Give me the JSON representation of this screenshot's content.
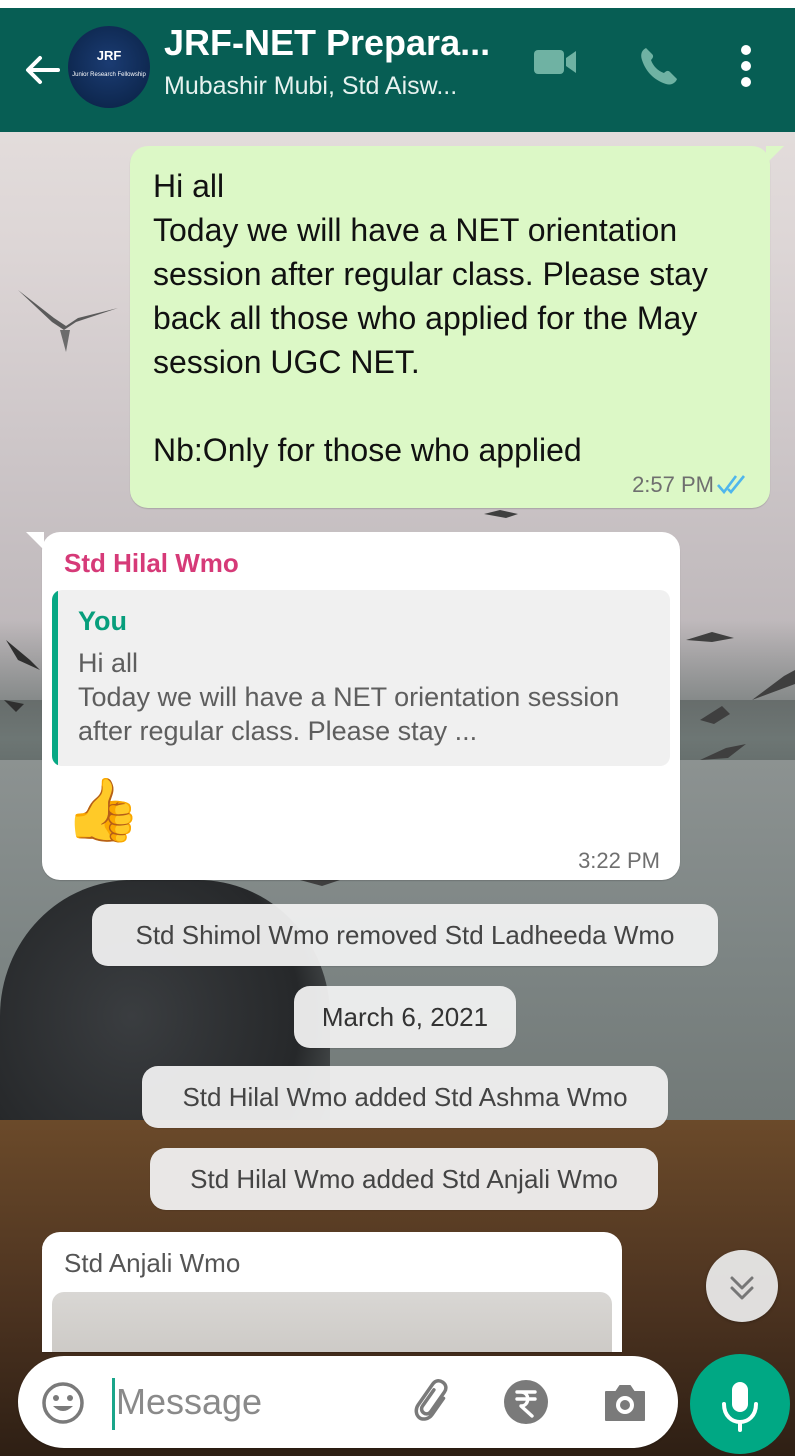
{
  "header": {
    "back_icon": "arrow-left-icon",
    "avatar": {
      "line1": "JRF",
      "line2": "Junior Research Fellowship"
    },
    "title": "JRF-NET Prepara...",
    "subtitle": "Mubashir Mubi, Std Aisw...",
    "icons": [
      "video-call-icon",
      "voice-call-icon",
      "more-vert-icon"
    ],
    "color": "#075e54"
  },
  "messages": [
    {
      "direction": "outgoing",
      "text": "Hi all\nToday we will have a NET orientation session after regular class. Please stay back all those who  applied for the May session UGC NET.\n\nNb:Only for those who applied",
      "time": "2:57 PM",
      "status": "read-double-tick"
    },
    {
      "direction": "incoming",
      "sender": "Std Hilal Wmo",
      "quote": {
        "author": "You",
        "text": "Hi all\nToday we will have a NET orientation session after regular class. Please stay ..."
      },
      "text": "👍",
      "time": "3:22 PM"
    }
  ],
  "system": {
    "removed": "Std Shimol Wmo removed Std Ladheeda Wmo",
    "date": "March 6, 2021",
    "added1": "Std Hilal Wmo added Std Ashma Wmo",
    "added2": "Std Hilal Wmo added Std Anjali Wmo"
  },
  "last_message": {
    "sender": "Std Anjali Wmo",
    "type": "image"
  },
  "composer": {
    "placeholder": "Message",
    "icons": [
      "emoji-icon",
      "attach-icon",
      "rupee-payment-icon",
      "camera-icon",
      "mic-icon"
    ]
  },
  "colors": {
    "outgoing_bubble": "#dcf8c6",
    "incoming_bubble": "#ffffff",
    "accent": "#00a884",
    "sender_name": "#d63a78",
    "quote_author": "#079e7c"
  }
}
